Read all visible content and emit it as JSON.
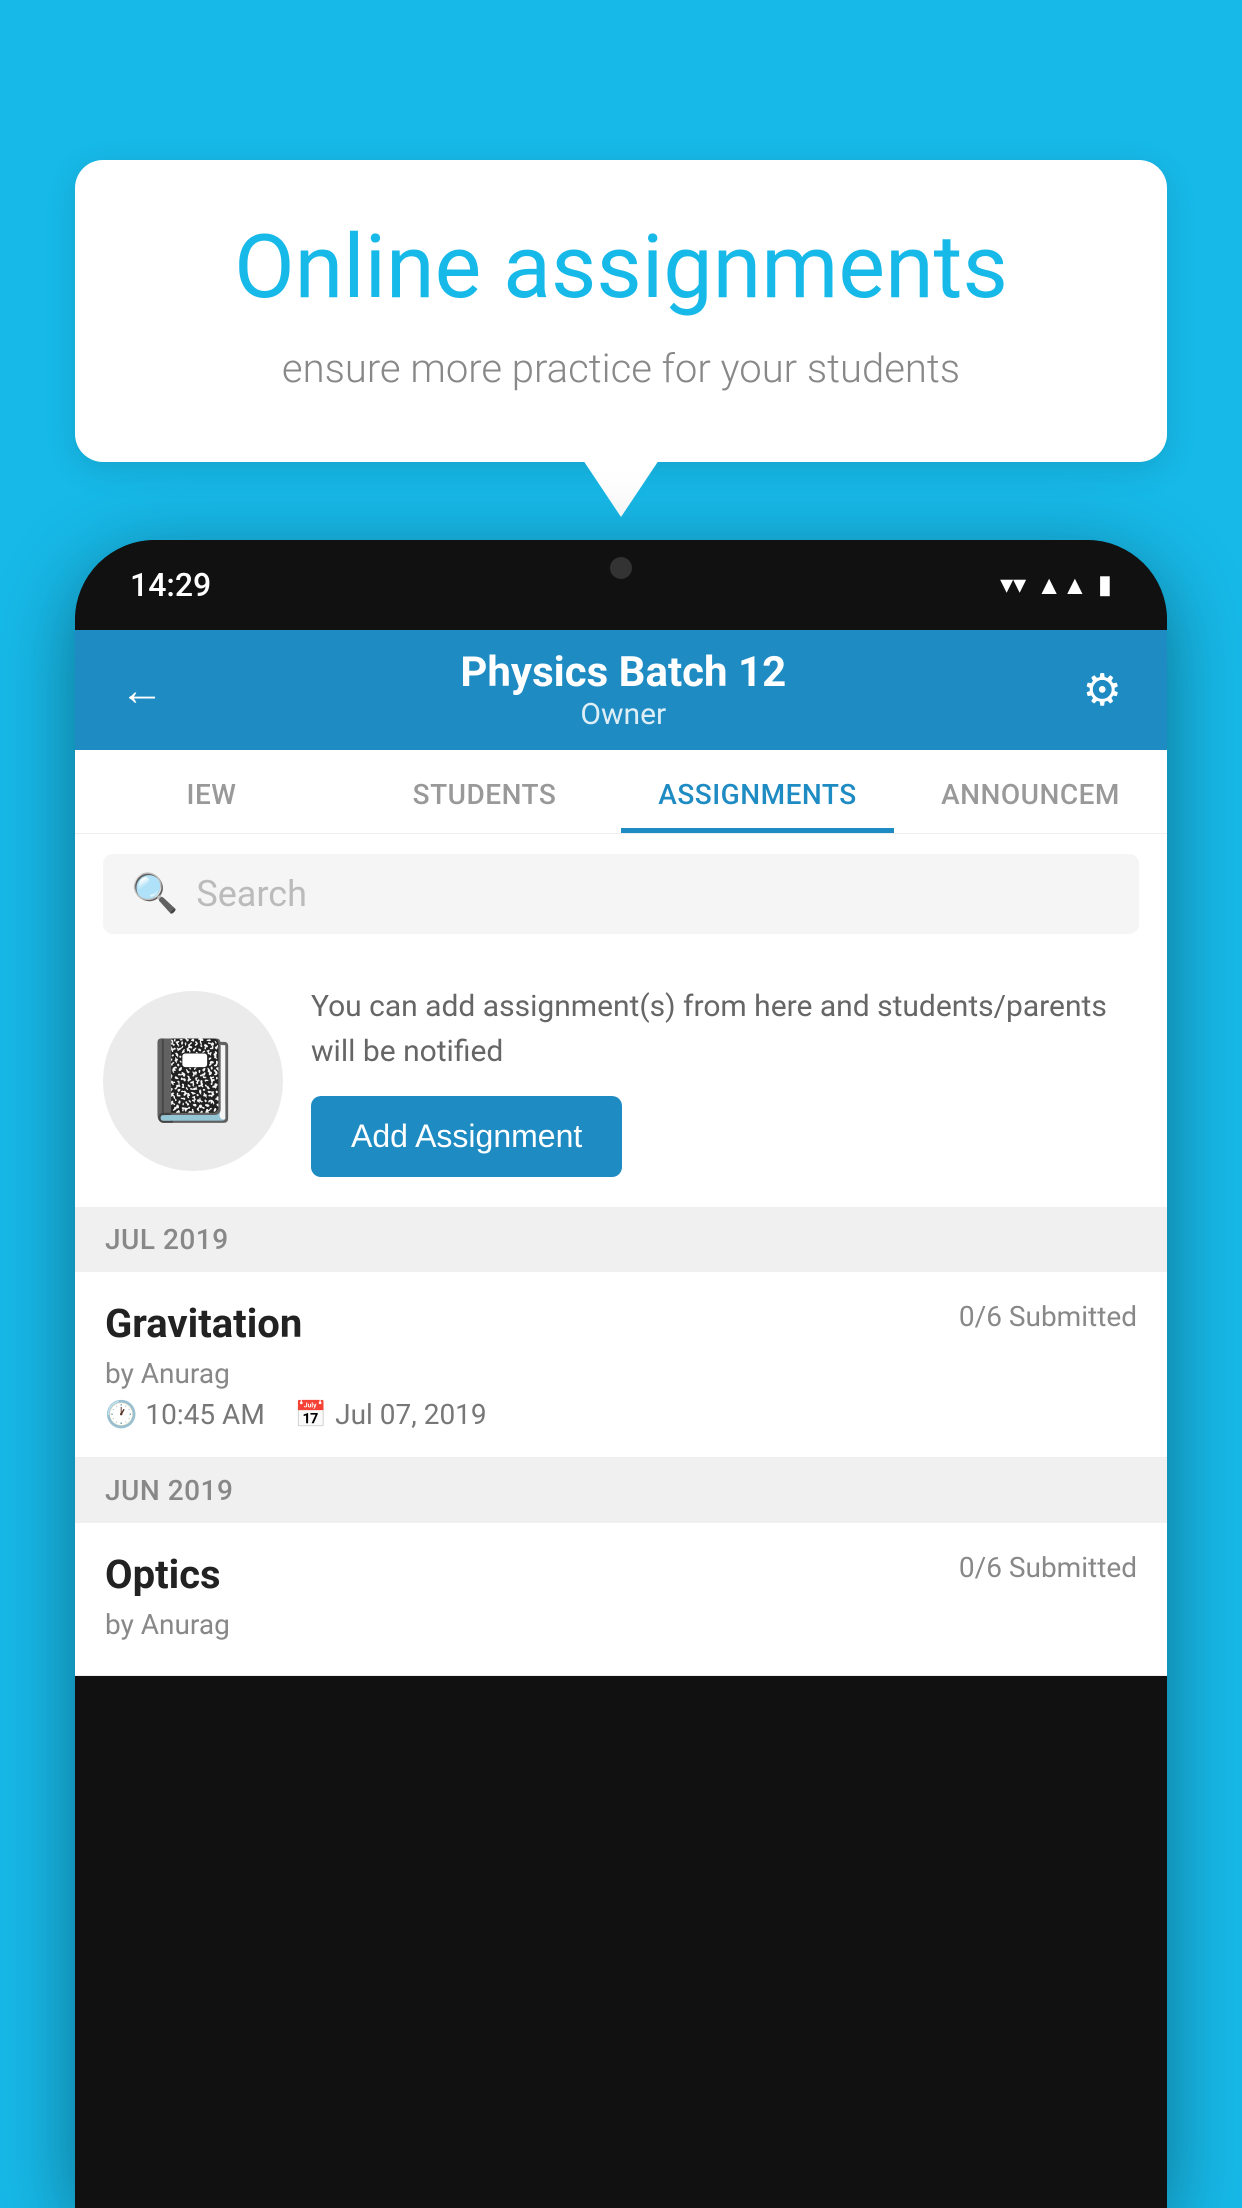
{
  "background_color": "#17b9e8",
  "speech_bubble": {
    "title": "Online assignments",
    "subtitle": "ensure more practice for your students"
  },
  "phone": {
    "status_bar": {
      "time": "14:29",
      "icons": [
        "wifi",
        "signal",
        "battery"
      ]
    },
    "header": {
      "title": "Physics Batch 12",
      "subtitle": "Owner",
      "back_label": "←",
      "settings_label": "⚙"
    },
    "tabs": [
      {
        "label": "IEW",
        "active": false
      },
      {
        "label": "STUDENTS",
        "active": false
      },
      {
        "label": "ASSIGNMENTS",
        "active": true
      },
      {
        "label": "ANNOUNCEM",
        "active": false
      }
    ],
    "search": {
      "placeholder": "Search"
    },
    "info_card": {
      "description": "You can add assignment(s) from here and students/parents will be notified",
      "button_label": "Add Assignment"
    },
    "sections": [
      {
        "label": "JUL 2019",
        "assignments": [
          {
            "name": "Gravitation",
            "submitted": "0/6 Submitted",
            "by": "by Anurag",
            "time": "10:45 AM",
            "date": "Jul 07, 2019"
          }
        ]
      },
      {
        "label": "JUN 2019",
        "assignments": [
          {
            "name": "Optics",
            "submitted": "0/6 Submitted",
            "by": "by Anurag",
            "time": "",
            "date": ""
          }
        ]
      }
    ]
  }
}
